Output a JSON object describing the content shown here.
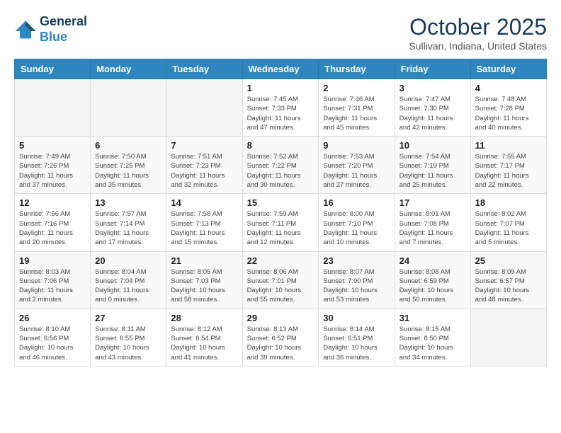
{
  "header": {
    "logo_line1": "General",
    "logo_line2": "Blue",
    "month": "October 2025",
    "location": "Sullivan, Indiana, United States"
  },
  "days_of_week": [
    "Sunday",
    "Monday",
    "Tuesday",
    "Wednesday",
    "Thursday",
    "Friday",
    "Saturday"
  ],
  "weeks": [
    [
      {
        "day": "",
        "info": ""
      },
      {
        "day": "",
        "info": ""
      },
      {
        "day": "",
        "info": ""
      },
      {
        "day": "1",
        "info": "Sunrise: 7:45 AM\nSunset: 7:33 PM\nDaylight: 11 hours\nand 47 minutes."
      },
      {
        "day": "2",
        "info": "Sunrise: 7:46 AM\nSunset: 7:31 PM\nDaylight: 11 hours\nand 45 minutes."
      },
      {
        "day": "3",
        "info": "Sunrise: 7:47 AM\nSunset: 7:30 PM\nDaylight: 11 hours\nand 42 minutes."
      },
      {
        "day": "4",
        "info": "Sunrise: 7:48 AM\nSunset: 7:28 PM\nDaylight: 11 hours\nand 40 minutes."
      }
    ],
    [
      {
        "day": "5",
        "info": "Sunrise: 7:49 AM\nSunset: 7:26 PM\nDaylight: 11 hours\nand 37 minutes."
      },
      {
        "day": "6",
        "info": "Sunrise: 7:50 AM\nSunset: 7:25 PM\nDaylight: 11 hours\nand 35 minutes."
      },
      {
        "day": "7",
        "info": "Sunrise: 7:51 AM\nSunset: 7:23 PM\nDaylight: 11 hours\nand 32 minutes."
      },
      {
        "day": "8",
        "info": "Sunrise: 7:52 AM\nSunset: 7:22 PM\nDaylight: 11 hours\nand 30 minutes."
      },
      {
        "day": "9",
        "info": "Sunrise: 7:53 AM\nSunset: 7:20 PM\nDaylight: 11 hours\nand 27 minutes."
      },
      {
        "day": "10",
        "info": "Sunrise: 7:54 AM\nSunset: 7:19 PM\nDaylight: 11 hours\nand 25 minutes."
      },
      {
        "day": "11",
        "info": "Sunrise: 7:55 AM\nSunset: 7:17 PM\nDaylight: 11 hours\nand 22 minutes."
      }
    ],
    [
      {
        "day": "12",
        "info": "Sunrise: 7:56 AM\nSunset: 7:16 PM\nDaylight: 11 hours\nand 20 minutes."
      },
      {
        "day": "13",
        "info": "Sunrise: 7:57 AM\nSunset: 7:14 PM\nDaylight: 11 hours\nand 17 minutes."
      },
      {
        "day": "14",
        "info": "Sunrise: 7:58 AM\nSunset: 7:13 PM\nDaylight: 11 hours\nand 15 minutes."
      },
      {
        "day": "15",
        "info": "Sunrise: 7:59 AM\nSunset: 7:11 PM\nDaylight: 11 hours\nand 12 minutes."
      },
      {
        "day": "16",
        "info": "Sunrise: 8:00 AM\nSunset: 7:10 PM\nDaylight: 11 hours\nand 10 minutes."
      },
      {
        "day": "17",
        "info": "Sunrise: 8:01 AM\nSunset: 7:08 PM\nDaylight: 11 hours\nand 7 minutes."
      },
      {
        "day": "18",
        "info": "Sunrise: 8:02 AM\nSunset: 7:07 PM\nDaylight: 11 hours\nand 5 minutes."
      }
    ],
    [
      {
        "day": "19",
        "info": "Sunrise: 8:03 AM\nSunset: 7:06 PM\nDaylight: 11 hours\nand 2 minutes."
      },
      {
        "day": "20",
        "info": "Sunrise: 8:04 AM\nSunset: 7:04 PM\nDaylight: 11 hours\nand 0 minutes."
      },
      {
        "day": "21",
        "info": "Sunrise: 8:05 AM\nSunset: 7:03 PM\nDaylight: 10 hours\nand 58 minutes."
      },
      {
        "day": "22",
        "info": "Sunrise: 8:06 AM\nSunset: 7:01 PM\nDaylight: 10 hours\nand 55 minutes."
      },
      {
        "day": "23",
        "info": "Sunrise: 8:07 AM\nSunset: 7:00 PM\nDaylight: 10 hours\nand 53 minutes."
      },
      {
        "day": "24",
        "info": "Sunrise: 8:08 AM\nSunset: 6:59 PM\nDaylight: 10 hours\nand 50 minutes."
      },
      {
        "day": "25",
        "info": "Sunrise: 8:09 AM\nSunset: 6:57 PM\nDaylight: 10 hours\nand 48 minutes."
      }
    ],
    [
      {
        "day": "26",
        "info": "Sunrise: 8:10 AM\nSunset: 6:56 PM\nDaylight: 10 hours\nand 46 minutes."
      },
      {
        "day": "27",
        "info": "Sunrise: 8:11 AM\nSunset: 6:55 PM\nDaylight: 10 hours\nand 43 minutes."
      },
      {
        "day": "28",
        "info": "Sunrise: 8:12 AM\nSunset: 6:54 PM\nDaylight: 10 hours\nand 41 minutes."
      },
      {
        "day": "29",
        "info": "Sunrise: 8:13 AM\nSunset: 6:52 PM\nDaylight: 10 hours\nand 39 minutes."
      },
      {
        "day": "30",
        "info": "Sunrise: 8:14 AM\nSunset: 6:51 PM\nDaylight: 10 hours\nand 36 minutes."
      },
      {
        "day": "31",
        "info": "Sunrise: 8:15 AM\nSunset: 6:50 PM\nDaylight: 10 hours\nand 34 minutes."
      },
      {
        "day": "",
        "info": ""
      }
    ]
  ]
}
